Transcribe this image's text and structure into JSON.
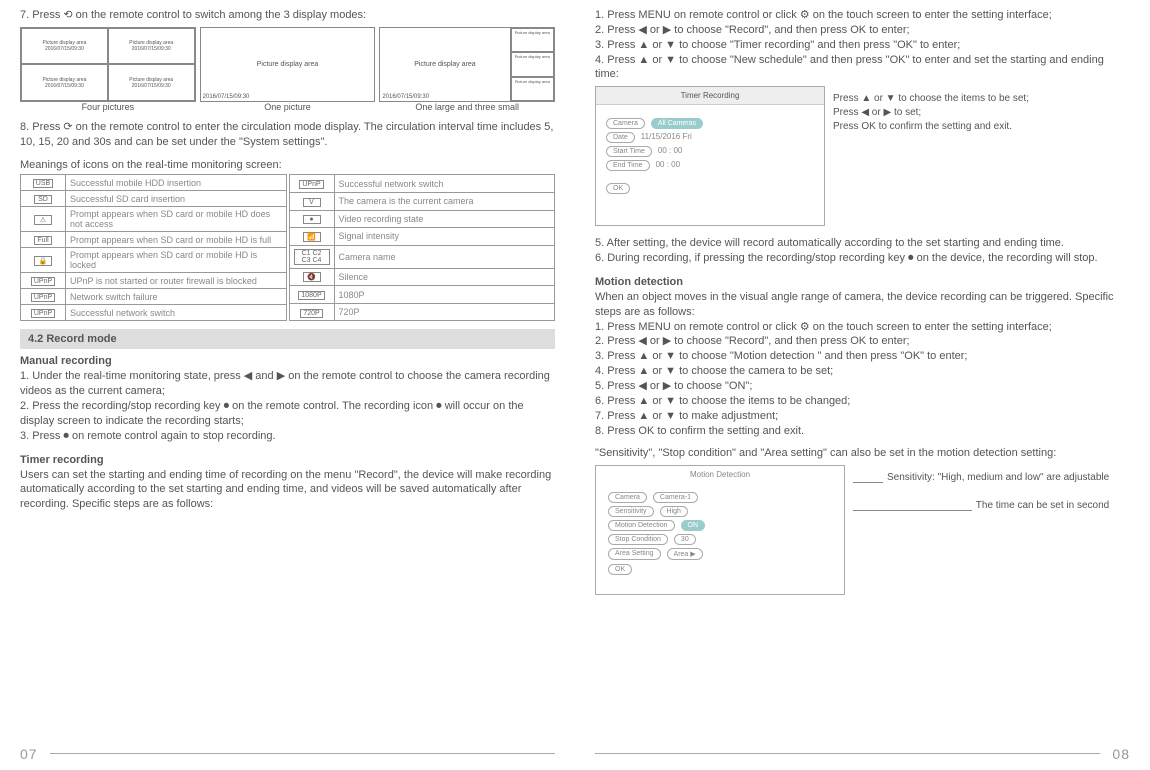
{
  "p7": {
    "step7": "7. Press ⟲ on the remote control to switch among the 3 display modes:",
    "modes": {
      "four": {
        "label": "Four pictures",
        "cell": "Picture display area",
        "ts": "2016/07/15/09:30"
      },
      "one": {
        "label": "One picture",
        "area": "Picture display area",
        "ts": "2016/07/15/09:30"
      },
      "onesmall": {
        "label": "One large and three small",
        "area": "Picture display area",
        "side": "Picture display area",
        "ts": "2016/07/15/09:30"
      }
    },
    "step8": "8. Press ⟳ on the remote control to enter the circulation mode display. The circulation interval time includes 5, 10, 15, 20 and 30s and can be set under the \"System settings\".",
    "meanings": "Meanings of icons on the real-time monitoring screen:",
    "iconsL": [
      {
        "i": "USB",
        "d": "Successful mobile HDD insertion"
      },
      {
        "i": "SD",
        "d": "Successful SD card insertion"
      },
      {
        "i": "⚠",
        "d": "Prompt appears when SD card or mobile HD does not access"
      },
      {
        "i": "Full",
        "d": "Prompt appears when SD card or mobile HD is full"
      },
      {
        "i": "🔒",
        "d": "Prompt appears when SD card or mobile HD is locked"
      },
      {
        "i": "UPnP",
        "d": "UPnP is not started or router firewall is blocked"
      },
      {
        "i": "UPnP",
        "d": "Network switch failure"
      },
      {
        "i": "UPnP",
        "d": "Successful network switch"
      }
    ],
    "iconsR": [
      {
        "i": "UPnP",
        "d": "Successful network switch"
      },
      {
        "i": "V",
        "d": "The camera is the current camera"
      },
      {
        "i": "●",
        "d": "Video recording state"
      },
      {
        "i": "📶",
        "d": "Signal intensity"
      },
      {
        "i": "C1 C2 C3 C4",
        "d": "Camera name"
      },
      {
        "i": "🔇",
        "d": "Silence"
      },
      {
        "i": "1080P",
        "d": "1080P"
      },
      {
        "i": "720P",
        "d": "720P"
      }
    ],
    "recordmode": "4.2 Record mode",
    "manual_h": "Manual recording",
    "manual": {
      "s1": "1. Under the real-time monitoring state, press ◀ and ▶ on the remote control to choose the camera recording videos as the current camera;",
      "s2": "2. Press the recording/stop recording key ⏺ on the remote control. The recording icon ⏺ will occur on the display screen to indicate the recording starts;",
      "s3": "3. Press ⏺ on remote control again to stop recording."
    },
    "timer_h": "Timer recording",
    "timer": "Users can set the starting and ending time of recording on the menu \"Record\", the device will make recording automatically according to the set starting and ending time, and videos will be saved automatically after recording. Specific steps are as follows:"
  },
  "p8": {
    "steps1": {
      "s1": "1. Press MENU on remote control or click ⚙ on the touch screen to enter the setting interface;",
      "s2": "2. Press ◀ or ▶ to choose \"Record\", and then press OK to enter;",
      "s3": "3. Press ▲ or ▼ to choose \"Timer recording\" and then press \"OK\" to enter;",
      "s4": "4. Press ▲ or ▼ to choose \"New schedule\" and then press \"OK\" to enter and set the starting and ending time:"
    },
    "timerui": {
      "title": "Timer Recording",
      "camera": "Camera",
      "cameraVal": "All Cameras",
      "date": "Date",
      "dateVal": "11/15/2016    Fri",
      "start": "Start Time",
      "startVal": "00    :    00",
      "end": "End Time",
      "endVal": "00    :    00",
      "ok": "OK"
    },
    "timernotes": "Press ▲ or ▼ to choose the items to be set;\nPress ◀ or ▶ to set;\nPress OK to confirm the setting and exit.",
    "step5": "5. After setting, the device will record automatically according to the set starting and ending time.",
    "step6": "6. During recording, if pressing the recording/stop recording key ⏺ on the device, the recording will stop.",
    "motion_h": "Motion detection",
    "motion_intro": "When an object moves in the visual angle range of camera, the device recording can be triggered. Specific steps are as follows:",
    "msteps": {
      "s1": "1. Press MENU on remote control or click ⚙ on the touch screen to enter the setting interface;",
      "s2": "2. Press ◀ or ▶ to choose \"Record\", and then press OK to enter;",
      "s3": "3. Press ▲ or ▼ to choose \"Motion detection \" and then press \"OK\" to enter;",
      "s4": "4. Press ▲ or ▼ to choose the camera to be set;",
      "s5": "5. Press ◀ or ▶ to choose \"ON\";",
      "s6": "6. Press ▲ or ▼ to choose the items to be changed;",
      "s7": "7. Press ▲ or ▼ to make adjustment;",
      "s8": "8. Press OK to confirm the setting and exit."
    },
    "sens_note": "\"Sensitivity\", \"Stop condition\" and \"Area setting\" can also be set in the motion detection setting:",
    "mdui": {
      "title": "Motion Detection",
      "camera": "Camera",
      "cameraVal": "Camera-1",
      "sens": "Sensitivity",
      "sensVal": "High",
      "md": "Motion Detection",
      "mdVal": "ON",
      "stop": "Stop Condition",
      "stopVal": "30",
      "area": "Area Setting",
      "areaVal": "Area ▶",
      "ok": "OK"
    },
    "mdnotes": {
      "n1": "Sensitivity: \"High, medium and low\" are adjustable",
      "n2": "The time can be set in second"
    }
  },
  "pagenums": {
    "l": "07",
    "r": "08"
  }
}
